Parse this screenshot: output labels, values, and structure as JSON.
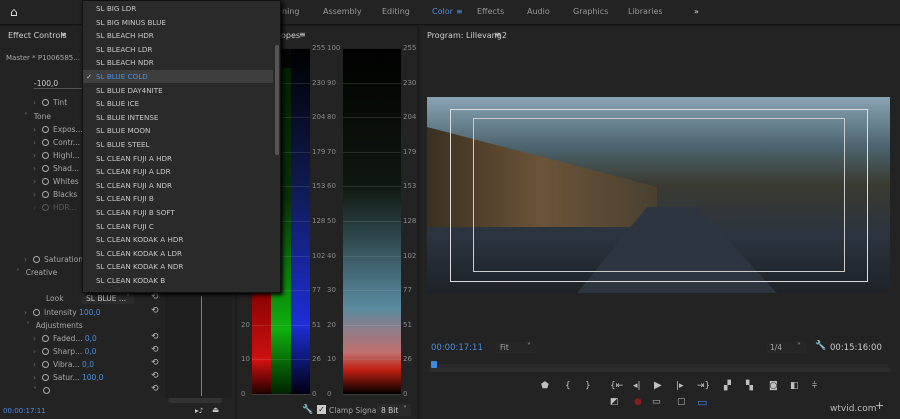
{
  "workspaces": {
    "items": [
      "ning",
      "Assembly",
      "Editing",
      "Color",
      "Effects",
      "Audio",
      "Graphics",
      "Libraries"
    ],
    "active": "Color",
    "more": "»"
  },
  "effect_controls": {
    "title": "Effect Controls",
    "clip": "Master * P1006585...",
    "temp_value": "-100,0",
    "rows": [
      {
        "label": "Tint"
      },
      {
        "label": "Tone"
      },
      {
        "label": "Expos..."
      },
      {
        "label": "Contr..."
      },
      {
        "label": "Highl..."
      },
      {
        "label": "Shad..."
      },
      {
        "label": "Whites"
      },
      {
        "label": "Blacks"
      },
      {
        "label": "HDR..."
      }
    ],
    "saturation": "Saturation",
    "creative": "Creative",
    "look_label": "Look",
    "look_value": "SL BLUE ...",
    "intensity_label": "Intensity",
    "intensity_value": "100,0",
    "adjustments": "Adjustments",
    "adj": [
      {
        "label": "Faded...",
        "value": "0,0"
      },
      {
        "label": "Sharp...",
        "value": "0,0"
      },
      {
        "label": "Vibra...",
        "value": "0,0"
      },
      {
        "label": "Satur...",
        "value": "100,0"
      }
    ],
    "timecode": "00:00:17:11"
  },
  "look_dropdown": {
    "selected": "SL BLUE COLD",
    "items": [
      "SL BIG LDR",
      "SL BIG MINUS BLUE",
      "SL BLEACH HDR",
      "SL BLEACH LDR",
      "SL BLEACH NDR",
      "SL BLUE COLD",
      "SL BLUE DAY4NITE",
      "SL BLUE ICE",
      "SL BLUE INTENSE",
      "SL BLUE MOON",
      "SL BLUE STEEL",
      "SL CLEAN FUJI A HDR",
      "SL CLEAN FUJI A LDR",
      "SL CLEAN FUJI A NDR",
      "SL CLEAN FUJI B",
      "SL CLEAN FUJI B SOFT",
      "SL CLEAN FUJI C",
      "SL CLEAN KODAK A HDR",
      "SL CLEAN KODAK A LDR",
      "SL CLEAN KODAK A NDR",
      "SL CLEAN KODAK B"
    ]
  },
  "scopes": {
    "title": "opes",
    "left_ticks": [
      "100",
      "90",
      "80",
      "70",
      "60",
      "50",
      "40",
      "30",
      "20",
      "10",
      "0"
    ],
    "right_ticks": [
      "255",
      "230",
      "204",
      "179",
      "153",
      "128",
      "102",
      "77",
      "51",
      "26",
      "0"
    ],
    "clamp_label": "Clamp Signal",
    "clamp_checked": true,
    "bit_depth": "8 Bit"
  },
  "program": {
    "title": "Program: Lillevang2",
    "timecode": "00:00:17:11",
    "zoom": "Fit",
    "resolution": "1/4",
    "duration": "00:15:16:00"
  },
  "watermark": "wtvid.com"
}
